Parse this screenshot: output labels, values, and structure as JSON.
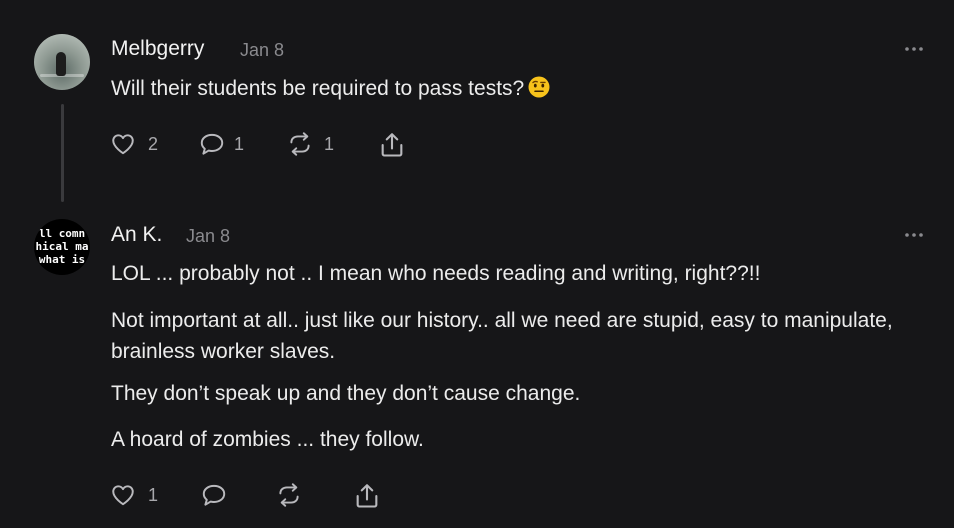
{
  "comments": [
    {
      "author": "Melbgerry",
      "date": "Jan 8",
      "avatar": "lake-bird-photo",
      "paragraphs": [
        "Will their students be required to pass tests?"
      ],
      "emoji": "raised-eyebrow-emoji",
      "likes": "2",
      "replies": "1",
      "restacks": "1",
      "icons": [
        "heart-icon",
        "speech-bubble-icon",
        "restack-icon",
        "share-icon",
        "more-icon"
      ]
    },
    {
      "author": "An K.",
      "date": "Jan 8",
      "avatar_text": [
        "ll comn",
        "hical ma",
        "what is"
      ],
      "paragraphs": [
        "LOL ... probably not .. I mean who needs reading and writing, right??!!",
        "Not important at all.. just like our history.. all we need are stupid, easy to manipulate, brainless worker slaves.",
        "They don’t speak up and they don’t cause change.",
        "A hoard of zombies ... they follow."
      ],
      "likes": "1",
      "icons": [
        "heart-icon",
        "speech-bubble-icon",
        "restack-icon",
        "share-icon",
        "more-icon"
      ]
    }
  ],
  "colors": {
    "background": "#161618",
    "text": "#ececec",
    "muted": "#8a8a8e",
    "icon": "#b9b9bd",
    "thread_line": "#3a3a3d"
  }
}
